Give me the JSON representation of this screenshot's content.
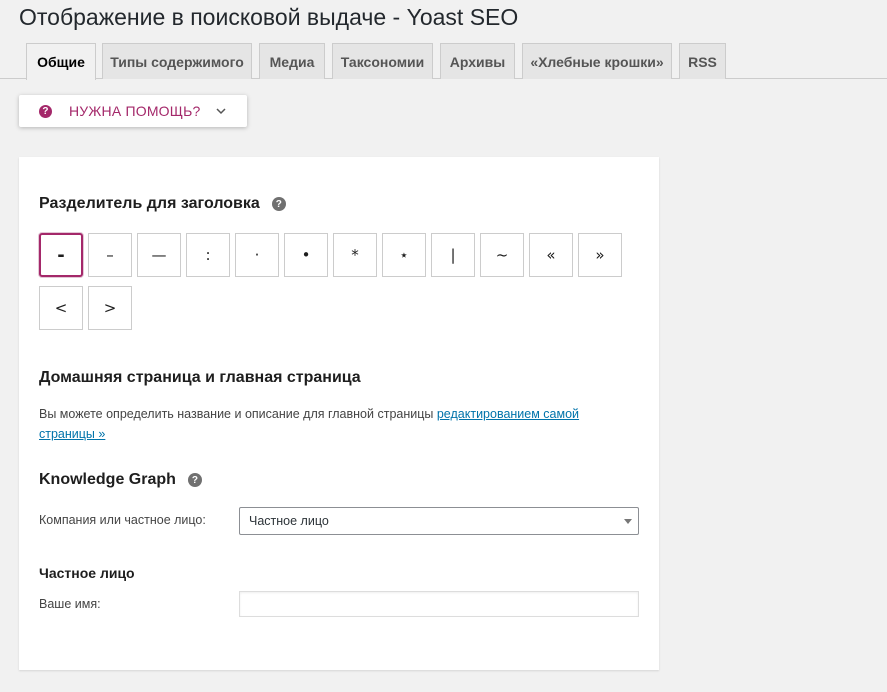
{
  "page": {
    "title": "Отображение в поисковой выдаче - Yoast SEO"
  },
  "tabs": [
    {
      "label": "Общие",
      "active": true
    },
    {
      "label": "Типы содержимого",
      "active": false
    },
    {
      "label": "Медиа",
      "active": false
    },
    {
      "label": "Таксономии",
      "active": false
    },
    {
      "label": "Архивы",
      "active": false
    },
    {
      "label": "«Хлебные крошки»",
      "active": false
    },
    {
      "label": "RSS",
      "active": false
    }
  ],
  "help": {
    "label": "НУЖНА ПОМОЩЬ?",
    "icon": "question-circle-icon",
    "glyph": "?",
    "accent": "#a4286a"
  },
  "separator": {
    "title": "Разделитель для заголовка",
    "info_glyph": "?",
    "options": [
      "-",
      "–",
      "—",
      ":",
      "·",
      "•",
      "*",
      "⋆",
      "|",
      "~",
      "«",
      "»",
      "<",
      ">"
    ],
    "selected_index": 0,
    "selected_color": "#a4286a"
  },
  "homepage": {
    "title": "Домашняя страница и главная страница",
    "description": "Вы можете определить название и описание для главной страницы ",
    "link_text": "редактированием самой страницы »"
  },
  "knowledge_graph": {
    "title": "Knowledge Graph",
    "info_glyph": "?",
    "type_label": "Компания или частное лицо:",
    "type_value": "Частное лицо",
    "person_title": "Частное лицо",
    "name_label": "Ваше имя:",
    "name_value": ""
  }
}
